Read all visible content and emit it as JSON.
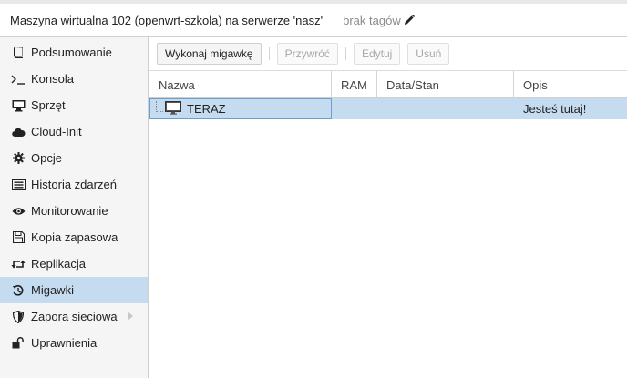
{
  "header": {
    "title": "Maszyna wirtualna 102 (openwrt-szkola) na serwerze 'nasz'",
    "tags_label": "brak tagów",
    "edit_icon": "pencil-icon"
  },
  "sidebar": {
    "items": [
      {
        "label": "Podsumowanie",
        "icon": "book-icon",
        "active": false
      },
      {
        "label": "Konsola",
        "icon": "terminal-icon",
        "active": false
      },
      {
        "label": "Sprzęt",
        "icon": "monitor-icon",
        "active": false
      },
      {
        "label": "Cloud-Init",
        "icon": "cloud-icon",
        "active": false
      },
      {
        "label": "Opcje",
        "icon": "gear-icon",
        "active": false
      },
      {
        "label": "Historia zdarzeń",
        "icon": "list-icon",
        "active": false
      },
      {
        "label": "Monitorowanie",
        "icon": "eye-icon",
        "active": false
      },
      {
        "label": "Kopia zapasowa",
        "icon": "floppy-icon",
        "active": false
      },
      {
        "label": "Replikacja",
        "icon": "retweet-icon",
        "active": false
      },
      {
        "label": "Migawki",
        "icon": "history-icon",
        "active": true
      },
      {
        "label": "Zapora sieciowa",
        "icon": "shield-icon",
        "active": false
      },
      {
        "label": "Uprawnienia",
        "icon": "unlock-icon",
        "active": false
      }
    ]
  },
  "toolbar": {
    "take_snapshot": "Wykonaj migawkę",
    "rollback": "Przywróć",
    "edit": "Edytuj",
    "remove": "Usuń"
  },
  "grid": {
    "columns": [
      "Nazwa",
      "RAM",
      "Data/Stan",
      "Opis"
    ],
    "rows": [
      {
        "name": "TERAZ",
        "ram": "",
        "date": "",
        "description": "Jesteś tutaj!",
        "icon": "monitor-icon",
        "selected": true
      }
    ]
  },
  "colors": {
    "selection": "#c5dcf0",
    "sidebar_bg": "#f5f5f5"
  }
}
